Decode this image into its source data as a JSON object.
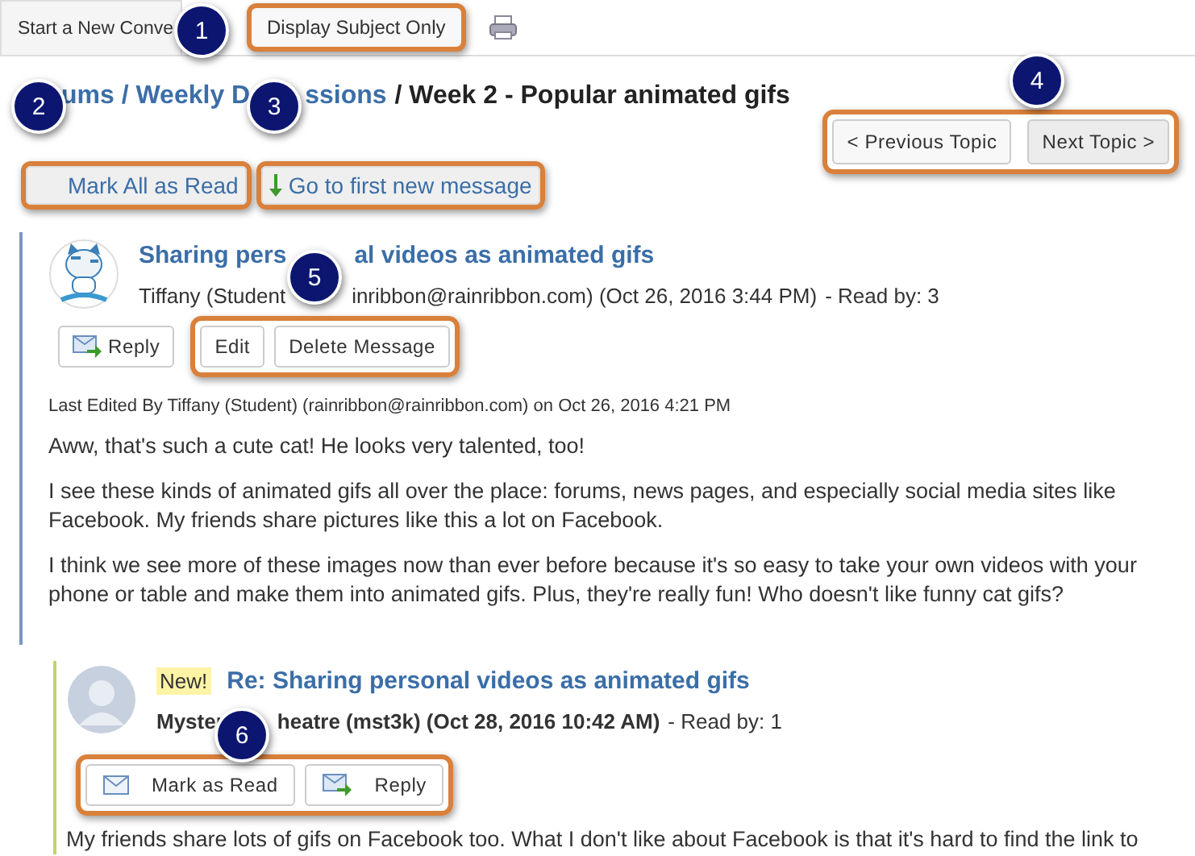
{
  "toolbar": {
    "tabs": [
      {
        "label": "Start a New Conve",
        "highlighted": false
      },
      {
        "label": "Display Subject Only",
        "highlighted": true
      }
    ]
  },
  "breadcrumb": [
    {
      "text": "ums / Weekly D",
      "kind": "link"
    },
    {
      "text": "ssions",
      "kind": "link"
    },
    {
      "text": "/ Week 2 - Popular animated gifs",
      "kind": "current"
    }
  ],
  "topic_nav": {
    "highlighted": true,
    "buttons": [
      "< Previous Topic",
      "Next Topic >"
    ]
  },
  "actions": [
    {
      "label": "Mark All as Read",
      "kind": "mark-all",
      "highlighted": true
    },
    {
      "label": "Go to first new message",
      "kind": "jump",
      "highlighted": true
    }
  ],
  "messages": [
    {
      "kind": "post",
      "title_parts": [
        "Sharing pers",
        "al videos as animated gifs"
      ],
      "author_parts": [
        "Tiffany (Student",
        "inribbon@rainribbon.com) (Oct 26, 2016 3:44 PM)"
      ],
      "read_by": "- Read by: 3",
      "button_groups": [
        {
          "highlighted": false,
          "buttons": [
            {
              "label": "Reply",
              "kind": "reply"
            }
          ]
        },
        {
          "highlighted": true,
          "buttons": [
            {
              "label": "Edit",
              "kind": "plain"
            },
            {
              "label": "Delete Message",
              "kind": "plain"
            }
          ]
        }
      ],
      "edited": "Last Edited By Tiffany (Student) (rainribbon@rainribbon.com) on Oct 26, 2016 4:21 PM",
      "paragraphs": [
        "Aww, that's such a cute cat!  He looks very talented, too!",
        "I see these kinds of animated gifs all over the place: forums, news pages, and especially social media sites like Facebook.  My friends share pictures like this a lot on Facebook.",
        "I think we see more of these images now than ever before because it's so easy to take your own videos with your phone or table and make them into animated gifs.  Plus, they're really fun!  Who doesn't like funny cat gifs?"
      ]
    },
    {
      "kind": "reply",
      "badge": "New!",
      "title_parts": [
        "Re: Sharing personal videos as animated gifs"
      ],
      "author_parts": [
        "Myster",
        "heatre (mst3k) (Oct 28, 2016 10:42 AM)"
      ],
      "read_by": "- Read by: 1",
      "button_groups": [
        {
          "highlighted": true,
          "buttons": [
            {
              "label": "Mark as Read",
              "kind": "mark-read"
            },
            {
              "label": "Reply",
              "kind": "reply"
            }
          ]
        }
      ],
      "paragraphs": [
        "My friends share lots of gifs on Facebook too.  What I don't like about Facebook is that it's hard to find the link to"
      ]
    }
  ],
  "callouts": [
    "1",
    "2",
    "3",
    "4",
    "5",
    "6"
  ]
}
